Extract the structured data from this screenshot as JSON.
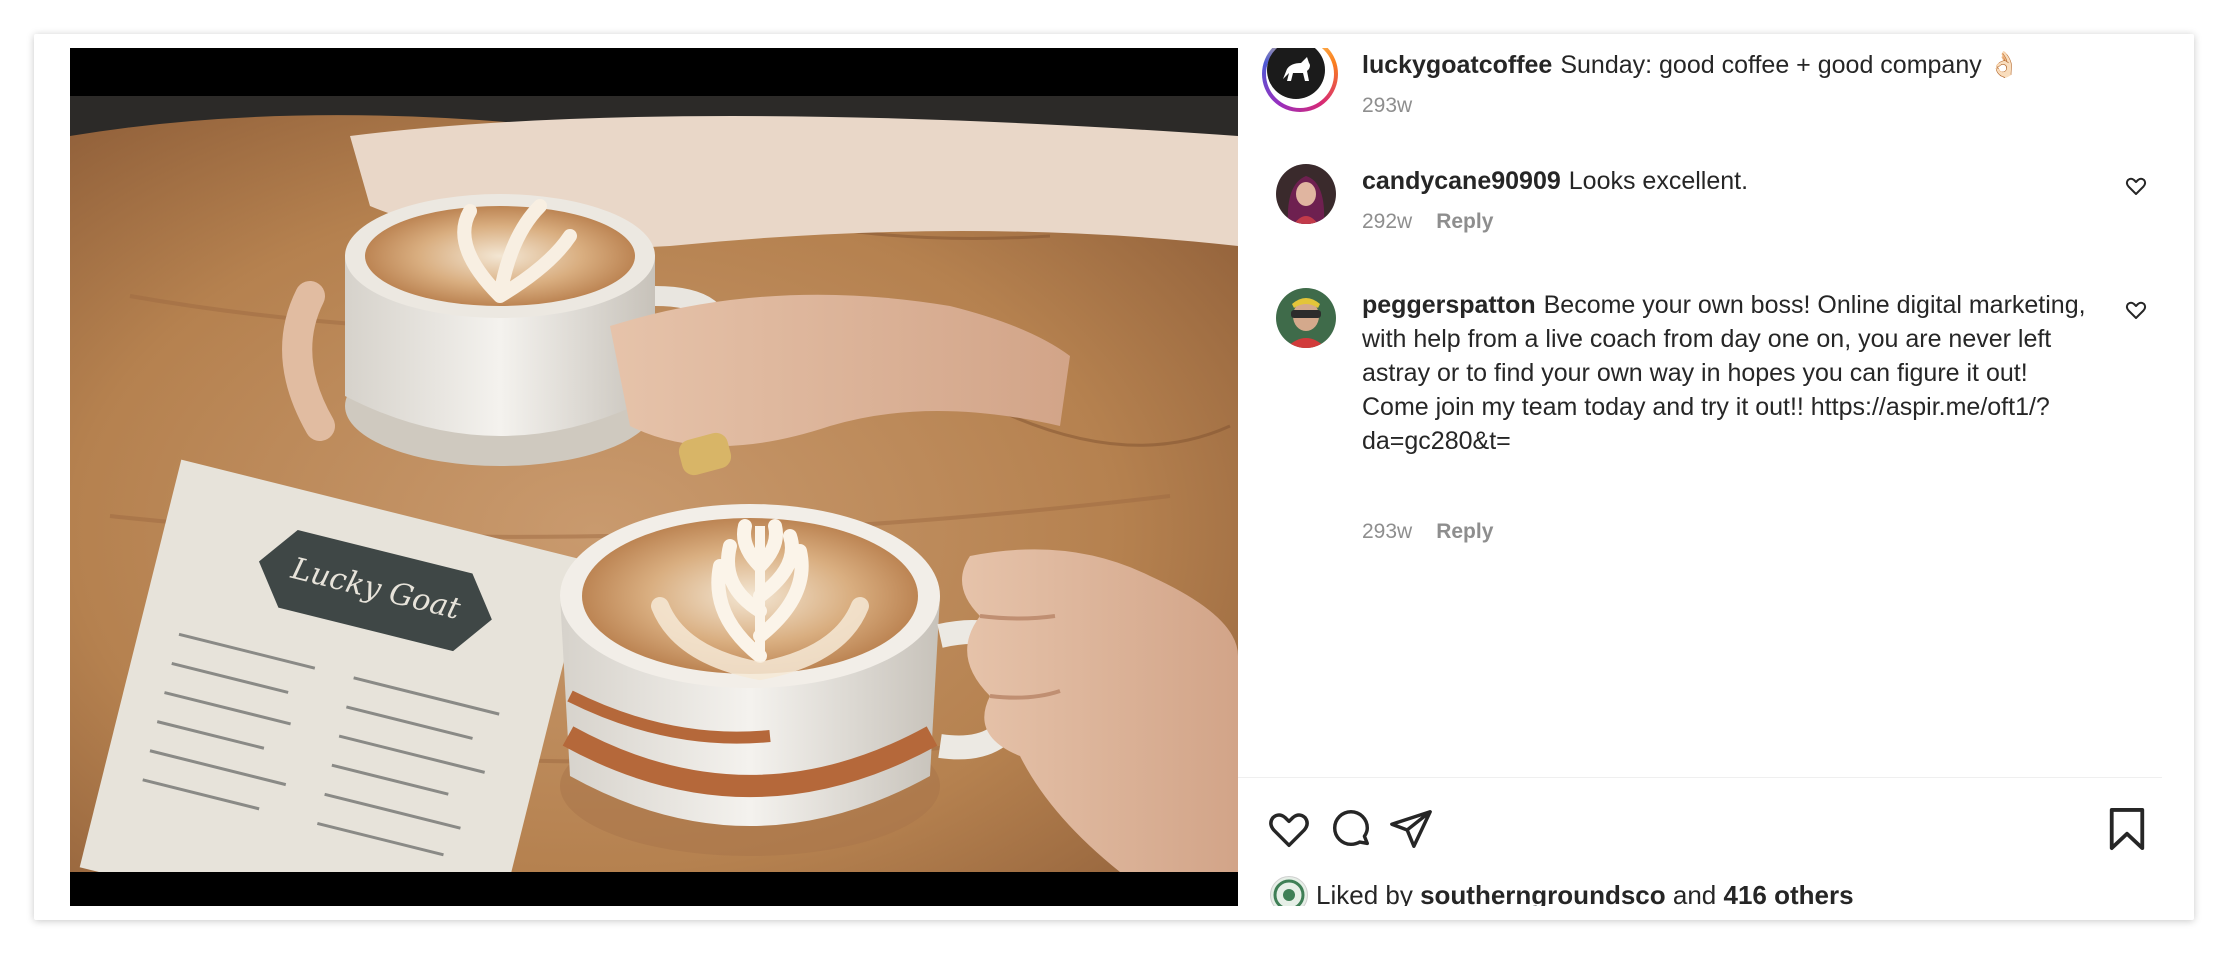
{
  "post": {
    "author": "luckygoatcoffee",
    "caption": "Sunday: good coffee + good company",
    "caption_emoji": "👌🏻",
    "age": "293w"
  },
  "comments": [
    {
      "username": "candycane90909",
      "text": "Looks excellent.",
      "age": "292w",
      "reply_label": "Reply"
    },
    {
      "username": "peggerspatton",
      "text": "Become your own boss! Online digital marketing, with help from a live coach from day one on, you are never left astray or to find your own way in hopes you can figure it out! Come join my team today and try it out!! https://aspir.me/oft1/?da=gc280&t=",
      "age": "293w",
      "reply_label": "Reply"
    }
  ],
  "likes": {
    "prefix": "Liked by",
    "liker": "southerngroundsco",
    "joiner": "and",
    "others": "416 others"
  },
  "icons": {
    "like": "heart-icon",
    "comment": "comment-bubble-icon",
    "share": "paper-plane-icon",
    "save": "bookmark-icon",
    "comment_like": "heart-small-icon"
  },
  "colors": {
    "text": "#262626",
    "muted": "#8e8e8e",
    "story_ring": "#d62976"
  }
}
